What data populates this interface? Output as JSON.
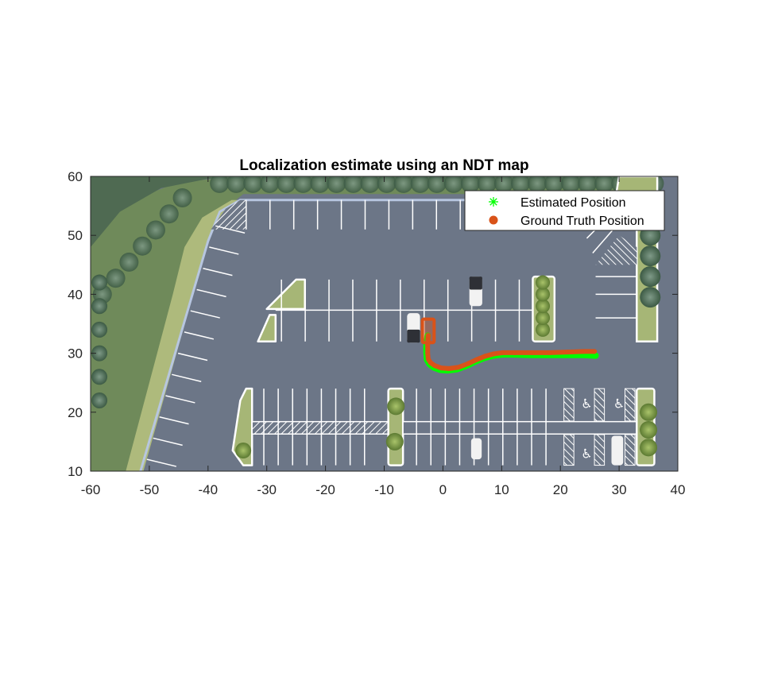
{
  "chart_data": {
    "type": "scatter",
    "title": "Localization estimate using an NDT map",
    "xlabel": "",
    "ylabel": "",
    "xlim": [
      -60,
      40
    ],
    "ylim": [
      10,
      60
    ],
    "xticks": [
      -60,
      -50,
      -40,
      -30,
      -20,
      -10,
      0,
      10,
      20,
      30,
      40
    ],
    "yticks": [
      10,
      20,
      30,
      40,
      50,
      60
    ],
    "xtick_labels": [
      "-60",
      "-50",
      "-40",
      "-30",
      "-20",
      "-10",
      "0",
      "10",
      "20",
      "30",
      "40"
    ],
    "ytick_labels": [
      "10",
      "20",
      "30",
      "40",
      "50",
      "60"
    ],
    "grid": false,
    "background": "aerial image of a parking lot",
    "legend": {
      "placement": "top-right",
      "entries": [
        {
          "label": "Estimated Position",
          "marker": "asterisk",
          "color": "#00ff00"
        },
        {
          "label": "Ground Truth Position",
          "marker": "filled-circle",
          "color": "#d95319"
        }
      ]
    },
    "series": [
      {
        "name": "Estimated Position",
        "color": "#00ff00",
        "x": [
          -2.6,
          -2.8,
          -2.8,
          -2.7,
          -2.3,
          -1.6,
          -0.5,
          0.8,
          2.4,
          4.0,
          5.5,
          7.0,
          8.5,
          10.0,
          12.0,
          15.0,
          18.0,
          21.0,
          24.0,
          26.0
        ],
        "y": [
          33.0,
          31.5,
          30.0,
          28.9,
          28.2,
          27.6,
          27.2,
          27.1,
          27.3,
          27.9,
          28.6,
          29.2,
          29.6,
          29.8,
          29.8,
          29.7,
          29.7,
          29.7,
          29.7,
          29.6
        ]
      },
      {
        "name": "Ground Truth Position",
        "color": "#d95319",
        "x": [
          -2.5,
          -2.6,
          -2.6,
          -2.5,
          -2.1,
          -1.4,
          -0.3,
          1.0,
          2.6,
          4.2,
          5.7,
          7.2,
          8.7,
          10.2,
          12.2,
          15.2,
          18.2,
          21.2,
          24.0,
          25.8
        ],
        "y": [
          33.0,
          31.5,
          30.0,
          29.0,
          28.4,
          27.9,
          27.5,
          27.4,
          27.6,
          28.2,
          28.9,
          29.5,
          29.9,
          30.1,
          30.1,
          30.1,
          30.1,
          30.2,
          30.3,
          30.3
        ]
      }
    ],
    "annotations": [
      {
        "type": "rectangle",
        "color": "#d95319",
        "x": [
          -3.5,
          -1.5
        ],
        "y": [
          31.8,
          35.8
        ],
        "label": ""
      }
    ]
  }
}
